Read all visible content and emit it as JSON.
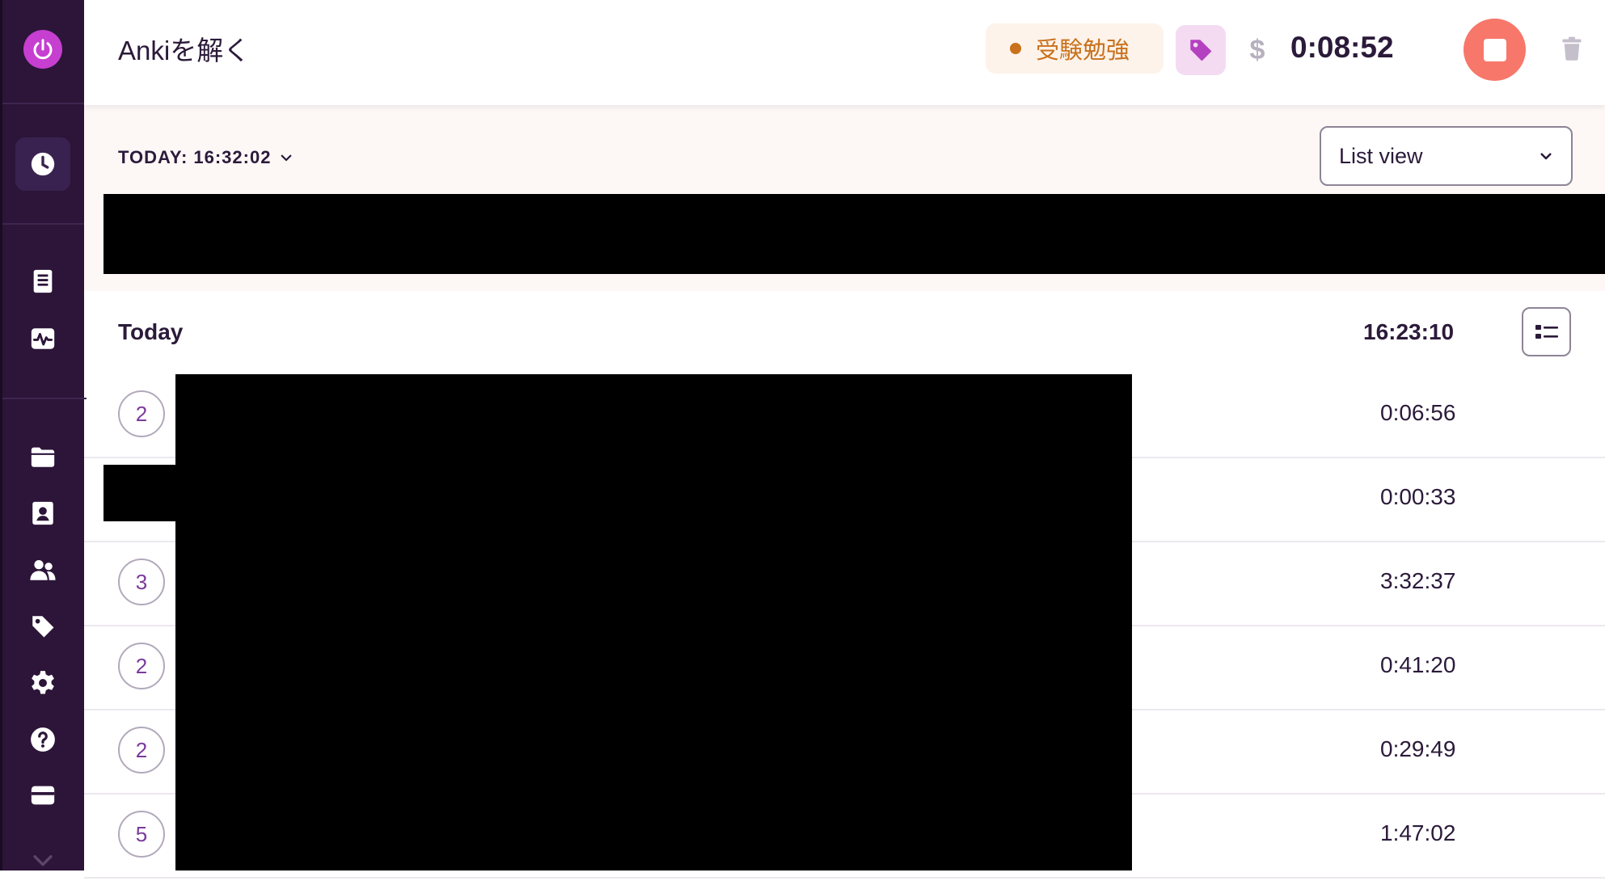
{
  "sidebar": {
    "icons": [
      "power-icon",
      "clock-icon",
      "report-icon",
      "activity-icon",
      "folder-icon",
      "client-icon",
      "team-icon",
      "tag-icon",
      "gear-icon",
      "help-icon",
      "billing-icon",
      "chevron-down-icon"
    ],
    "active_item": "clock-icon",
    "accent_color": "#c63fd0",
    "background_color": "#2c1538"
  },
  "topbar": {
    "task_title": "Ankiを解く",
    "project": {
      "name": "受験勉強",
      "color": "#c9711c"
    },
    "tag_icon": "tag-icon",
    "billable_icon": "dollar-icon",
    "billable_symbol": "$",
    "timer": "0:08:52",
    "stop_icon": "stop-icon",
    "stop_color": "#f7776a",
    "delete_icon": "trash-icon"
  },
  "datebar": {
    "date_label": "TODAY: 16:32:02",
    "view_select": {
      "selected": "List view"
    }
  },
  "day_group": {
    "title": "Today",
    "total": "16:23:10",
    "group_toggle_icon": "list-group-icon"
  },
  "entries": [
    {
      "count": "2",
      "duration": "0:06:56"
    },
    {
      "count": "",
      "duration": "0:00:33"
    },
    {
      "count": "3",
      "duration": "3:32:37"
    },
    {
      "count": "2",
      "duration": "0:41:20"
    },
    {
      "count": "2",
      "duration": "0:29:49"
    },
    {
      "count": "5",
      "duration": "1:47:02"
    }
  ]
}
